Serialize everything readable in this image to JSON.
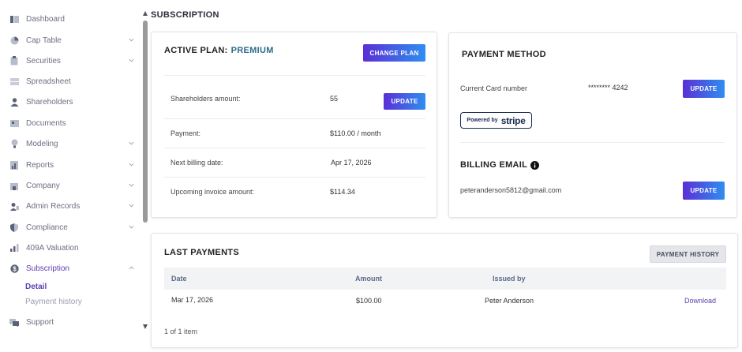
{
  "sidebar": {
    "items": [
      {
        "label": "Dashboard",
        "icon": "dashboard-icon",
        "expandable": false
      },
      {
        "label": "Cap Table",
        "icon": "pie-chart-icon",
        "expandable": true
      },
      {
        "label": "Securities",
        "icon": "clipboard-icon",
        "expandable": true
      },
      {
        "label": "Spreadsheet",
        "icon": "spreadsheet-icon",
        "expandable": false
      },
      {
        "label": "Shareholders",
        "icon": "user-icon",
        "expandable": false
      },
      {
        "label": "Documents",
        "icon": "folder-icon",
        "expandable": false
      },
      {
        "label": "Modeling",
        "icon": "lightbulb-icon",
        "expandable": true
      },
      {
        "label": "Reports",
        "icon": "report-icon",
        "expandable": true
      },
      {
        "label": "Company",
        "icon": "building-icon",
        "expandable": true
      },
      {
        "label": "Admin Records",
        "icon": "admin-icon",
        "expandable": true
      },
      {
        "label": "Compliance",
        "icon": "shield-icon",
        "expandable": true
      },
      {
        "label": "409A Valuation",
        "icon": "valuation-icon",
        "expandable": false
      },
      {
        "label": "Subscription",
        "icon": "dollar-icon",
        "expandable": true,
        "expanded": true,
        "active": true
      },
      {
        "label": "Support",
        "icon": "chat-icon",
        "expandable": false
      }
    ],
    "subscription_children": [
      {
        "label": "Detail",
        "active": true
      },
      {
        "label": "Payment history",
        "active": false
      }
    ]
  },
  "page": {
    "title": "SUBSCRIPTION"
  },
  "plan": {
    "heading": "ACTIVE PLAN:",
    "name": "PREMIUM",
    "change_button": "CHANGE PLAN",
    "rows": [
      {
        "label": "Shareholders amount:",
        "value": "55",
        "button": "UPDATE"
      },
      {
        "label": "Payment:",
        "value": "$110.00 / month"
      },
      {
        "label": "Next billing date:",
        "value": "Apr 17, 2026"
      },
      {
        "label": "Upcoming invoice amount:",
        "value": "$114.34"
      }
    ]
  },
  "payment_method": {
    "heading": "PAYMENT METHOD",
    "card_label": "Current Card number",
    "card_value": "******** 4242",
    "update_button": "UPDATE",
    "badge_powered": "Powered by",
    "badge_brand": "stripe",
    "billing_heading": "BILLING EMAIL",
    "email": "peteranderson5812@gmail.com",
    "email_update_button": "UPDATE"
  },
  "payments": {
    "heading": "LAST PAYMENTS",
    "history_button": "PAYMENT HISTORY",
    "columns": [
      "Date",
      "Amount",
      "Issued by"
    ],
    "rows": [
      {
        "date": "Mar 17, 2026",
        "amount": "$100.00",
        "issued_by": "Peter Anderson",
        "action": "Download"
      }
    ],
    "footer": "1 of 1 item"
  },
  "colors": {
    "accent": "#5b3fb0",
    "button_gradient_start": "#5a2fd6",
    "button_gradient_end": "#2f8ef0",
    "plan_name": "#2b6c8a"
  }
}
